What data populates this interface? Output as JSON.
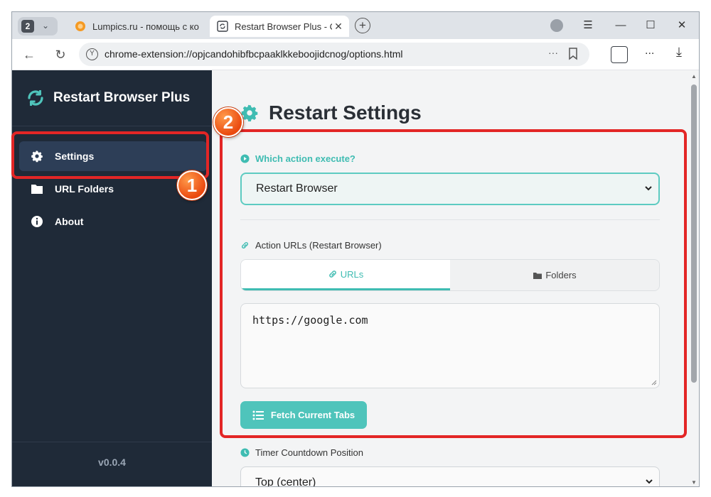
{
  "browser": {
    "tab_count": "2",
    "tabs": [
      {
        "label": "Lumpics.ru - помощь с ко",
        "favicon": "orange-circle-icon"
      },
      {
        "label": "Restart Browser Plus - О",
        "favicon": "restart-extension-icon"
      }
    ],
    "address": "chrome-extension://opjcandohibfbcpaaklkkeboojidcnog/options.html",
    "address_more": "···",
    "menu_dots": "...",
    "new_tab": "+"
  },
  "sidebar": {
    "brand": "Restart Browser Plus",
    "items": [
      {
        "label": "Settings",
        "icon": "gear-icon",
        "active": true
      },
      {
        "label": "URL Folders",
        "icon": "folder-icon",
        "active": false
      },
      {
        "label": "About",
        "icon": "info-icon",
        "active": false
      }
    ],
    "version": "v0.0.4"
  },
  "main": {
    "title": "Restart Settings",
    "action_label": "Which action execute?",
    "action_value": "Restart Browser",
    "urls_label": "Action URLs (Restart Browser)",
    "url_tabs": [
      {
        "label": "URLs",
        "icon": "link-icon",
        "active": true
      },
      {
        "label": "Folders",
        "icon": "folder-icon",
        "active": false
      }
    ],
    "urls_text": "https://google.com",
    "fetch_button": "Fetch Current Tabs",
    "timer_label": "Timer Countdown Position",
    "timer_value": "Top (center)"
  },
  "annotations": {
    "badge_1": "1",
    "badge_2": "2",
    "color": "#e32626"
  },
  "colors": {
    "accent": "#3fbcb2",
    "sidebar_bg": "#1f2a38"
  }
}
